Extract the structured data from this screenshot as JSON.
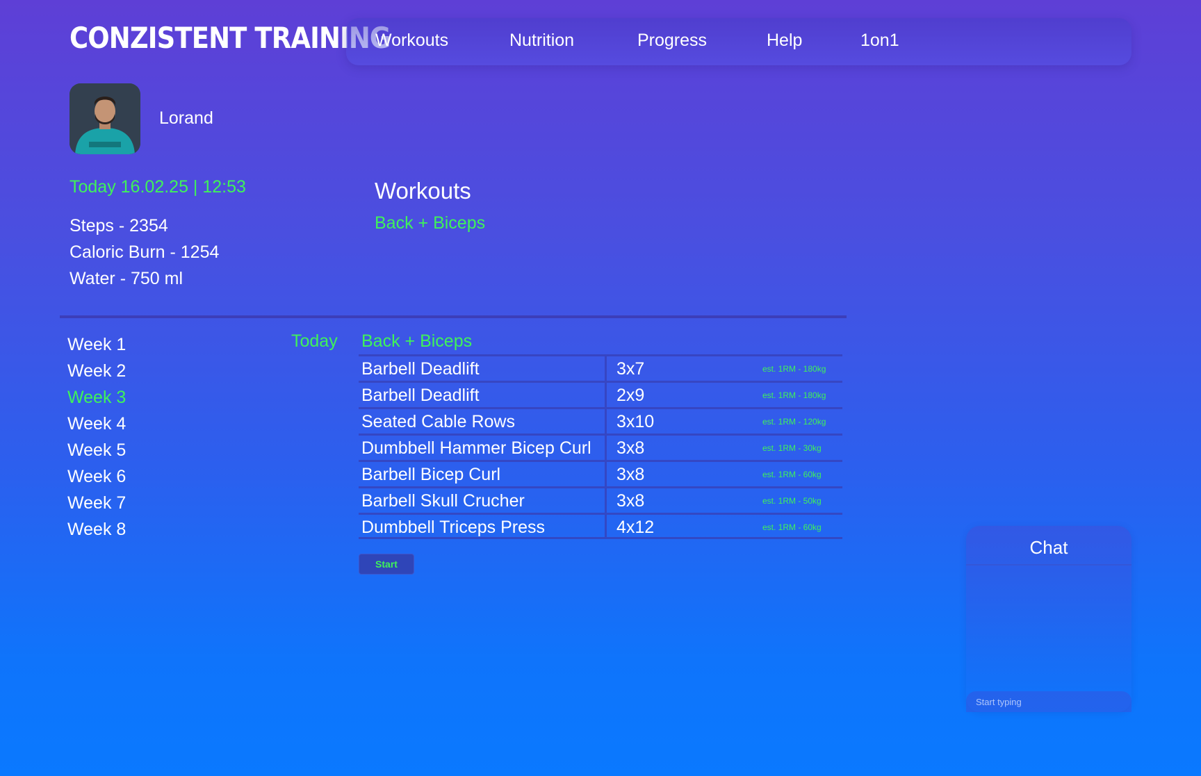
{
  "brand": {
    "logo": "CONZISTENT TRAINING"
  },
  "nav": {
    "items": [
      "Workouts",
      "Nutrition",
      "Progress",
      "Help",
      "1on1"
    ]
  },
  "user": {
    "name": "Lorand"
  },
  "today": {
    "label": "Today 16.02.25 | 12:53"
  },
  "stats": [
    "Steps - 2354",
    "Caloric Burn - 1254",
    "Water - 750 ml"
  ],
  "workouts": {
    "title": "Workouts",
    "current": "Back + Biceps"
  },
  "weeks": [
    "Week 1",
    "Week 2",
    "Week 3",
    "Week 4",
    "Week 5",
    "Week 6",
    "Week 7",
    "Week 8"
  ],
  "active_week": "Week 3",
  "plan": {
    "today_label": "Today",
    "title": "Back + Biceps",
    "exercises": [
      {
        "name": "Barbell Deadlift",
        "sets": "3x7",
        "est": "est. 1RM - 180kg"
      },
      {
        "name": "Barbell Deadlift",
        "sets": "2x9",
        "est": "est. 1RM - 180kg"
      },
      {
        "name": "Seated Cable Rows",
        "sets": "3x10",
        "est": "est. 1RM - 120kg"
      },
      {
        "name": "Dumbbell Hammer Bicep Curl",
        "sets": "3x8",
        "est": "est. 1RM - 30kg"
      },
      {
        "name": "Barbell Bicep Curl",
        "sets": "3x8",
        "est": "est. 1RM - 60kg"
      },
      {
        "name": "Barbell Skull Crucher",
        "sets": "3x8",
        "est": "est. 1RM - 50kg"
      },
      {
        "name": "Dumbbell Triceps Press",
        "sets": "4x12",
        "est": "est. 1RM - 60kg"
      }
    ],
    "start_label": "Start"
  },
  "chat": {
    "title": "Chat",
    "placeholder": "Start typing"
  },
  "colors": {
    "accent_green": "#3ff25a",
    "bg_top": "#5e3fd6",
    "bg_bottom": "#0a79ff"
  }
}
